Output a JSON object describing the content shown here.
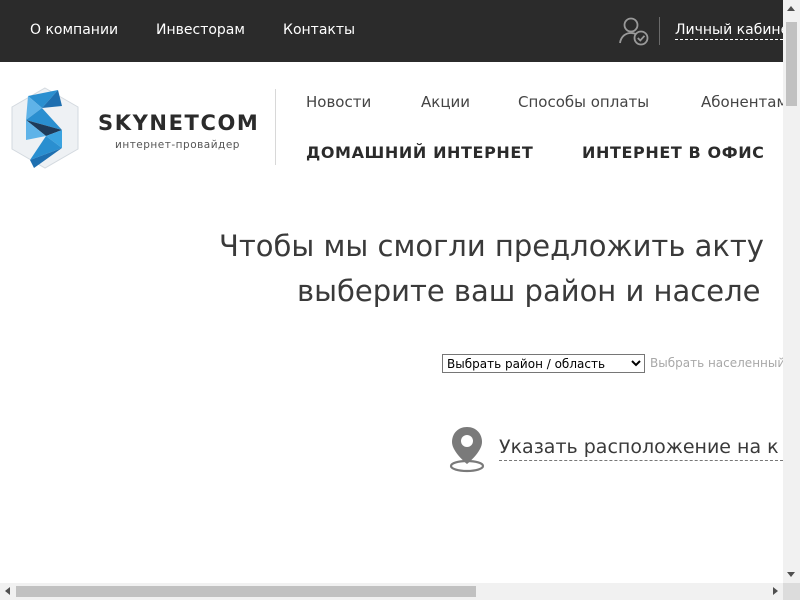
{
  "topbar": {
    "links": [
      {
        "label": "О компании"
      },
      {
        "label": "Инвесторам"
      },
      {
        "label": "Контакты"
      }
    ],
    "cabinet_label": "Личный кабинет"
  },
  "header": {
    "logo_title": "SKYNETCOM",
    "logo_subtitle": "интернет-провайдер",
    "nav_primary": [
      {
        "label": "Новости"
      },
      {
        "label": "Акции"
      },
      {
        "label": "Способы оплаты"
      },
      {
        "label": "Абонентам"
      }
    ],
    "nav_secondary": [
      {
        "label": "ДОМАШНИЙ ИНТЕРНЕТ"
      },
      {
        "label": "ИНТЕРНЕТ В ОФИС"
      }
    ]
  },
  "main": {
    "headline_line1": "Чтобы мы смогли предложить акту",
    "headline_line2": "выберите ваш район и населе",
    "region_select": {
      "selected": "Выбрать район / область"
    },
    "locality_placeholder": "Выбрать населенный",
    "location_link": "Указать расположение на к"
  },
  "colors": {
    "topbar_bg": "#2b2b2b",
    "logo_blue": "#2a8fd0",
    "logo_dark": "#1e3b5a",
    "text_dark": "#3a3a3a"
  },
  "icons": {
    "user": "user-check-icon",
    "pin": "map-pin-icon"
  }
}
